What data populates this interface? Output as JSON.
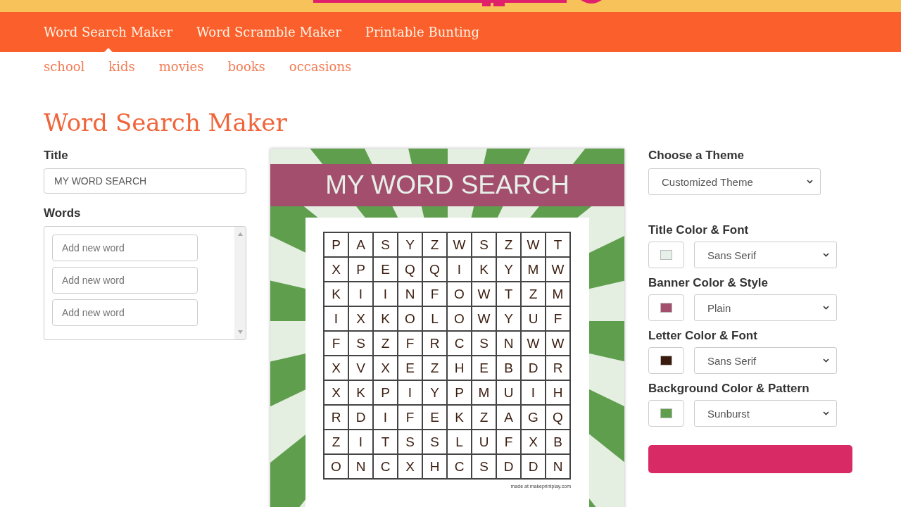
{
  "nav": [
    {
      "label": "Word Search Maker",
      "selected": true
    },
    {
      "label": "Word Scramble Maker",
      "selected": false
    },
    {
      "label": "Printable Bunting",
      "selected": false
    }
  ],
  "subnav": [
    "school",
    "kids",
    "movies",
    "books",
    "occasions"
  ],
  "heading": "Word Search Maker",
  "title_field": {
    "label": "Title",
    "value": "MY WORD SEARCH"
  },
  "words": {
    "label": "Words",
    "fields": [
      {
        "placeholder": "Add new word"
      },
      {
        "placeholder": "Add new word"
      },
      {
        "placeholder": "Add new word"
      }
    ]
  },
  "preview": {
    "title": "MY WORD SEARCH",
    "grid": [
      [
        "P",
        "A",
        "S",
        "Y",
        "Z",
        "W",
        "S",
        "Z",
        "W",
        "T"
      ],
      [
        "X",
        "P",
        "E",
        "Q",
        "Q",
        "I",
        "K",
        "Y",
        "M",
        "W"
      ],
      [
        "K",
        "I",
        "I",
        "N",
        "F",
        "O",
        "W",
        "T",
        "Z",
        "M"
      ],
      [
        "I",
        "X",
        "K",
        "O",
        "L",
        "O",
        "W",
        "Y",
        "U",
        "F"
      ],
      [
        "F",
        "S",
        "Z",
        "F",
        "R",
        "C",
        "S",
        "N",
        "W",
        "W"
      ],
      [
        "X",
        "V",
        "X",
        "E",
        "Z",
        "H",
        "E",
        "B",
        "D",
        "R"
      ],
      [
        "X",
        "K",
        "P",
        "I",
        "Y",
        "P",
        "M",
        "U",
        "I",
        "H"
      ],
      [
        "R",
        "D",
        "I",
        "F",
        "E",
        "K",
        "Z",
        "A",
        "G",
        "Q"
      ],
      [
        "Z",
        "I",
        "T",
        "S",
        "S",
        "L",
        "U",
        "F",
        "X",
        "B"
      ],
      [
        "O",
        "N",
        "C",
        "X",
        "H",
        "C",
        "S",
        "D",
        "D",
        "N"
      ]
    ],
    "credit": "made at makeprintplay.com"
  },
  "theme": {
    "label": "Choose a Theme",
    "value": "Customized Theme"
  },
  "settings": [
    {
      "label": "Title Color & Font",
      "color": "#e6efe8",
      "value": "Sans Serif"
    },
    {
      "label": "Banner Color & Style",
      "color": "#a44e6e",
      "value": "Plain"
    },
    {
      "label": "Letter Color & Font",
      "color": "#3a1c0e",
      "value": "Sans Serif"
    },
    {
      "label": "Background Color & Pattern",
      "color": "#5f9e4d",
      "value": "Sunburst"
    }
  ]
}
